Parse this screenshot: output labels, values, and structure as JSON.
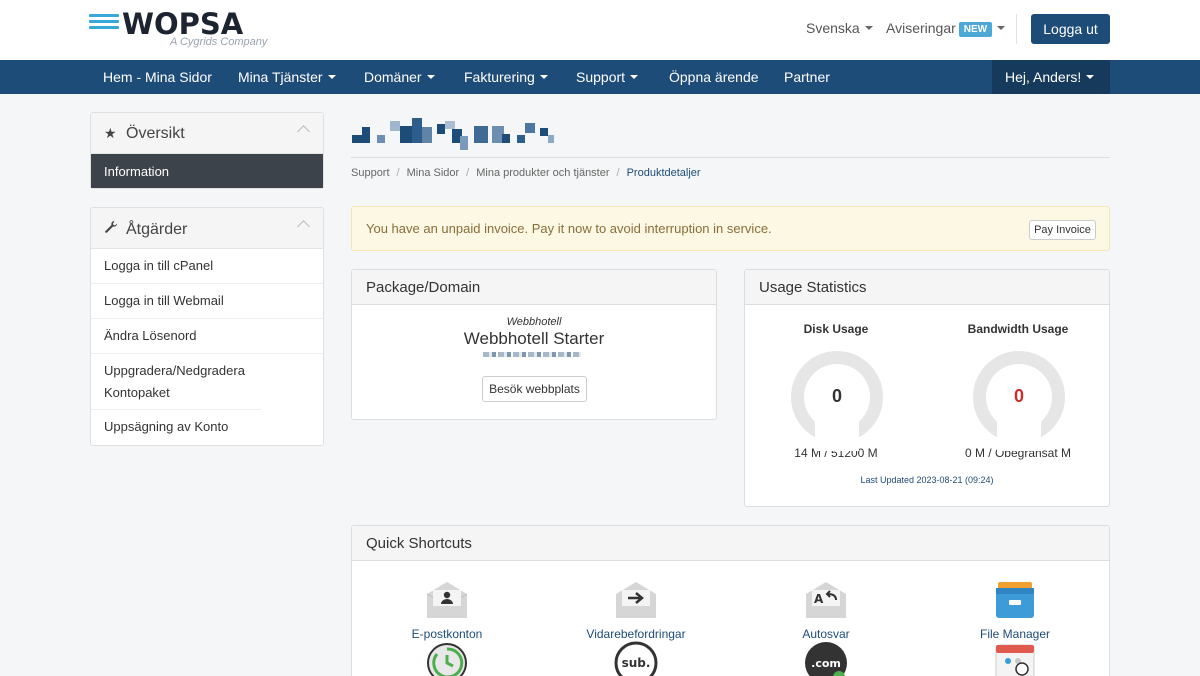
{
  "brand": {
    "name": "WOPSA",
    "tagline": "A Cygrids Company"
  },
  "header": {
    "language": "Svenska",
    "notifications": "Aviseringar",
    "new_badge": "NEW",
    "logout": "Logga ut"
  },
  "nav": {
    "items": [
      {
        "label": "Hem - Mina Sidor",
        "dropdown": false
      },
      {
        "label": "Mina Tjänster",
        "dropdown": true
      },
      {
        "label": "Domäner",
        "dropdown": true
      },
      {
        "label": "Fakturering",
        "dropdown": true
      },
      {
        "label": "Support",
        "dropdown": true
      },
      {
        "label": "Öppna ärende",
        "dropdown": false
      },
      {
        "label": "Partner",
        "dropdown": false
      }
    ],
    "user": "Hej, Anders!"
  },
  "sidebar": {
    "overview": {
      "title": "Översikt",
      "icon": "star-icon",
      "items": [
        "Information"
      ]
    },
    "actions": {
      "title": "Åtgärder",
      "icon": "wrench-icon",
      "items": [
        "Logga in till cPanel",
        "Logga in till Webmail",
        "Ändra Lösenord",
        "Uppgradera/Nedgradera Kontopaket",
        "Uppsägning av Konto"
      ]
    }
  },
  "breadcrumb": [
    "Support",
    "Mina Sidor",
    "Mina produkter och tjänster",
    "Produktdetaljer"
  ],
  "alert": {
    "text": "You have an unpaid invoice. Pay it now to avoid interruption in service.",
    "button": "Pay Invoice"
  },
  "package": {
    "title": "Package/Domain",
    "type": "Webbhotell",
    "name": "Webbhotell Starter",
    "visit_button": "Besök webbplats"
  },
  "usage": {
    "title": "Usage Statistics",
    "disk": {
      "label": "Disk Usage",
      "value": "0",
      "detail": "14 M / 51200 M"
    },
    "bandwidth": {
      "label": "Bandwidth Usage",
      "value": "0",
      "detail": "0 M / Obegränsat M"
    },
    "last_updated": "Last Updated 2023-08-21 (09:24)",
    "colors": {
      "disk_value": "#333333",
      "bandwidth_value": "#c9302c",
      "gauge_track": "#e6e6e6"
    }
  },
  "shortcuts": {
    "title": "Quick Shortcuts",
    "items": [
      {
        "label": "E-postkonton",
        "icon": "email-accounts-icon"
      },
      {
        "label": "Vidarebefordringar",
        "icon": "forwarders-icon"
      },
      {
        "label": "Autosvar",
        "icon": "autoresponders-icon"
      },
      {
        "label": "File Manager",
        "icon": "file-manager-icon"
      }
    ],
    "row2_icons": [
      "cron-jobs-icon",
      "subdomains-icon",
      "addon-domains-icon",
      "calendar-icon"
    ],
    "row2_texts": [
      "sub.",
      ".com"
    ]
  },
  "colors": {
    "primary": "#1e4c78",
    "accent": "#4ea8d5",
    "alert_bg": "#fcf8e3"
  }
}
